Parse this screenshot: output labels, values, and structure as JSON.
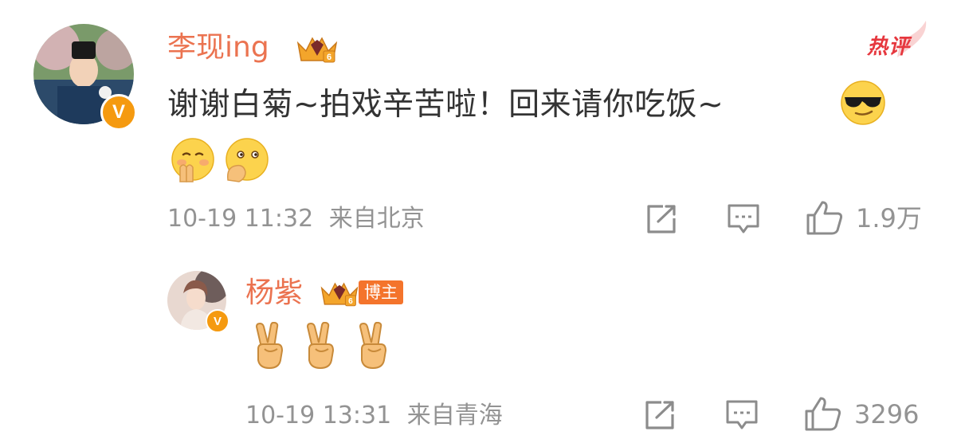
{
  "comment": {
    "username": "李现ing",
    "hot_tag": "热评",
    "text": "谢谢白菊~拍戏辛苦啦！回来请你吃饭~",
    "verified_badge": "V",
    "timestamp": "10-19 11:32",
    "location": "来自北京",
    "like_count": "1.9万",
    "emoji_inline": "sunglasses-emoji",
    "emojis_after": [
      "pray-emoji",
      "thinking-emoji"
    ]
  },
  "reply": {
    "username": "杨紫",
    "role_tag": "博主",
    "verified_badge": "V",
    "emojis": [
      "victory-hand-emoji",
      "victory-hand-emoji",
      "victory-hand-emoji"
    ],
    "timestamp": "10-19 13:31",
    "location": "来自青海",
    "like_count": "3296"
  },
  "colors": {
    "username": "#eb7350",
    "meta_text": "#939393",
    "body_text": "#333333",
    "verified_badge": "#f59a10",
    "hot_tag": "#e6373e",
    "blogger_tag": "#f4742c"
  },
  "icons": {
    "share": "share-icon",
    "comment": "comment-icon",
    "like": "thumbs-up-icon",
    "crown": "vip-crown-icon"
  }
}
